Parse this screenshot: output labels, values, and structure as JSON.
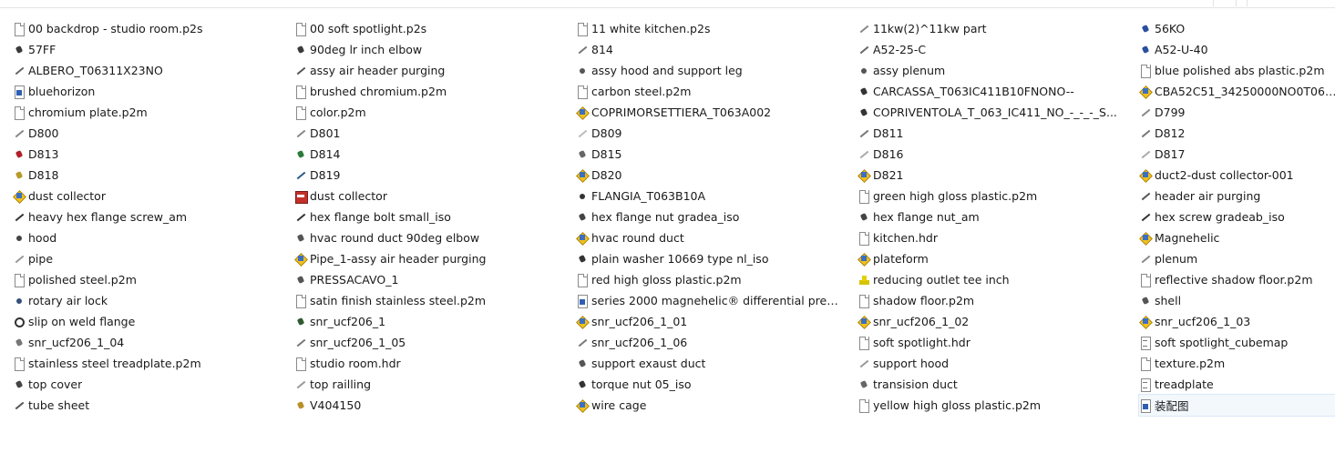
{
  "window": {
    "tabs": [
      "",
      ""
    ]
  },
  "files": [
    [
      {
        "name": "00 backdrop - studio room.p2s",
        "icon": "file-icon",
        "kind": "file"
      },
      {
        "name": "57FF",
        "icon": "part-icon",
        "kind": "part",
        "color": "#3a3a3a"
      },
      {
        "name": "ALBERO_T06311X23NO",
        "icon": "part-icon",
        "kind": "line",
        "color": "#666"
      },
      {
        "name": "bluehorizon",
        "icon": "image-file-icon",
        "kind": "doc-blue"
      },
      {
        "name": "chromium plate.p2m",
        "icon": "file-icon",
        "kind": "file"
      },
      {
        "name": "D800",
        "icon": "part-icon",
        "kind": "line",
        "color": "#888"
      },
      {
        "name": "D813",
        "icon": "part-icon",
        "kind": "part",
        "color": "#b0202a"
      },
      {
        "name": "D818",
        "icon": "part-icon",
        "kind": "part",
        "color": "#b89a2a"
      },
      {
        "name": "dust collector",
        "icon": "assembly-icon",
        "kind": "asm"
      },
      {
        "name": "heavy hex flange screw_am",
        "icon": "part-icon",
        "kind": "line",
        "color": "#333"
      },
      {
        "name": "hood",
        "icon": "part-icon",
        "kind": "dot",
        "color": "#444"
      },
      {
        "name": "pipe",
        "icon": "part-icon",
        "kind": "line",
        "color": "#999"
      },
      {
        "name": "polished steel.p2m",
        "icon": "file-icon",
        "kind": "file"
      },
      {
        "name": "rotary air lock",
        "icon": "part-icon",
        "kind": "dot",
        "color": "#35507a"
      },
      {
        "name": "slip on weld flange",
        "icon": "part-icon",
        "kind": "ring"
      },
      {
        "name": "snr_ucf206_1_04",
        "icon": "part-icon",
        "kind": "part",
        "color": "#777"
      },
      {
        "name": "stainless steel treadplate.p2m",
        "icon": "file-icon",
        "kind": "file"
      },
      {
        "name": "top cover",
        "icon": "part-icon",
        "kind": "part",
        "color": "#444"
      },
      {
        "name": "tube sheet",
        "icon": "part-icon",
        "kind": "line",
        "color": "#555"
      }
    ],
    [
      {
        "name": "00 soft spotlight.p2s",
        "icon": "file-icon",
        "kind": "file"
      },
      {
        "name": "90deg lr inch elbow",
        "icon": "part-icon",
        "kind": "part",
        "color": "#3a3a3a"
      },
      {
        "name": "assy air header purging",
        "icon": "part-icon",
        "kind": "line",
        "color": "#555"
      },
      {
        "name": "brushed chromium.p2m",
        "icon": "file-icon",
        "kind": "file"
      },
      {
        "name": "color.p2m",
        "icon": "file-icon",
        "kind": "file"
      },
      {
        "name": "D801",
        "icon": "part-icon",
        "kind": "line",
        "color": "#888"
      },
      {
        "name": "D814",
        "icon": "part-icon",
        "kind": "part",
        "color": "#2a7a3a"
      },
      {
        "name": "D819",
        "icon": "part-icon",
        "kind": "line",
        "color": "#2e5a8a"
      },
      {
        "name": "dust collector",
        "icon": "assembly-icon",
        "kind": "asm-red"
      },
      {
        "name": "hex flange bolt small_iso",
        "icon": "part-icon",
        "kind": "line",
        "color": "#333"
      },
      {
        "name": "hvac round duct 90deg elbow",
        "icon": "part-icon",
        "kind": "part",
        "color": "#555"
      },
      {
        "name": "Pipe_1-assy air header purging",
        "icon": "assembly-icon",
        "kind": "asm"
      },
      {
        "name": "PRESSACAVO_1",
        "icon": "part-icon",
        "kind": "part",
        "color": "#555"
      },
      {
        "name": "satin finish stainless steel.p2m",
        "icon": "file-icon",
        "kind": "file"
      },
      {
        "name": "snr_ucf206_1",
        "icon": "part-icon",
        "kind": "part",
        "color": "#2f5a2f"
      },
      {
        "name": "snr_ucf206_1_05",
        "icon": "part-icon",
        "kind": "line",
        "color": "#777"
      },
      {
        "name": "studio room.hdr",
        "icon": "file-icon",
        "kind": "file"
      },
      {
        "name": "top railling",
        "icon": "part-icon",
        "kind": "line",
        "color": "#999"
      },
      {
        "name": "V404150",
        "icon": "part-icon",
        "kind": "part",
        "color": "#b8902a"
      }
    ],
    [
      {
        "name": "11 white kitchen.p2s",
        "icon": "file-icon",
        "kind": "file"
      },
      {
        "name": "814",
        "icon": "part-icon",
        "kind": "line",
        "color": "#777"
      },
      {
        "name": "assy hood and support leg",
        "icon": "part-icon",
        "kind": "dot",
        "color": "#555"
      },
      {
        "name": "carbon steel.p2m",
        "icon": "file-icon",
        "kind": "file"
      },
      {
        "name": "COPRIMORSETTIERA_T063A002",
        "icon": "assembly-icon",
        "kind": "asm"
      },
      {
        "name": "D809",
        "icon": "part-icon",
        "kind": "line",
        "color": "#bbb"
      },
      {
        "name": "D815",
        "icon": "part-icon",
        "kind": "part",
        "color": "#666"
      },
      {
        "name": "D820",
        "icon": "assembly-icon",
        "kind": "asm"
      },
      {
        "name": "FLANGIA_T063B10A",
        "icon": "part-icon",
        "kind": "dot",
        "color": "#333"
      },
      {
        "name": "hex flange nut gradea_iso",
        "icon": "part-icon",
        "kind": "part",
        "color": "#444"
      },
      {
        "name": "hvac round duct",
        "icon": "assembly-icon",
        "kind": "asm"
      },
      {
        "name": "plain washer 10669 type nl_iso",
        "icon": "part-icon",
        "kind": "part",
        "color": "#333"
      },
      {
        "name": "red high gloss plastic.p2m",
        "icon": "file-icon",
        "kind": "file"
      },
      {
        "name": "series 2000 magnehelic® differential pres...",
        "icon": "image-file-icon",
        "kind": "doc-blue"
      },
      {
        "name": "snr_ucf206_1_01",
        "icon": "assembly-icon",
        "kind": "asm"
      },
      {
        "name": "snr_ucf206_1_06",
        "icon": "part-icon",
        "kind": "line",
        "color": "#777"
      },
      {
        "name": "support exaust duct",
        "icon": "part-icon",
        "kind": "part",
        "color": "#555"
      },
      {
        "name": "torque nut 05_iso",
        "icon": "part-icon",
        "kind": "part",
        "color": "#333"
      },
      {
        "name": "wire cage",
        "icon": "assembly-icon",
        "kind": "asm"
      }
    ],
    [
      {
        "name": "11kw(2)^11kw part",
        "icon": "part-icon",
        "kind": "line",
        "color": "#888"
      },
      {
        "name": "A52-25-C",
        "icon": "part-icon",
        "kind": "line",
        "color": "#666"
      },
      {
        "name": "assy plenum",
        "icon": "part-icon",
        "kind": "dot",
        "color": "#555"
      },
      {
        "name": "CARCASSA_T063IC411B10FNONO--",
        "icon": "part-icon",
        "kind": "part",
        "color": "#333"
      },
      {
        "name": "COPRIVENTOLA_T_063_IC411_NO_-_-_-_S...",
        "icon": "part-icon",
        "kind": "part",
        "color": "#333"
      },
      {
        "name": "D811",
        "icon": "part-icon",
        "kind": "line",
        "color": "#777"
      },
      {
        "name": "D816",
        "icon": "part-icon",
        "kind": "line",
        "color": "#aaa"
      },
      {
        "name": "D821",
        "icon": "assembly-icon",
        "kind": "asm"
      },
      {
        "name": "green high gloss plastic.p2m",
        "icon": "file-icon",
        "kind": "file"
      },
      {
        "name": "hex flange nut_am",
        "icon": "part-icon",
        "kind": "part",
        "color": "#444"
      },
      {
        "name": "kitchen.hdr",
        "icon": "file-icon",
        "kind": "file"
      },
      {
        "name": "plateform",
        "icon": "assembly-icon",
        "kind": "asm"
      },
      {
        "name": "reducing outlet tee inch",
        "icon": "part-icon",
        "kind": "tee"
      },
      {
        "name": "shadow floor.p2m",
        "icon": "file-icon",
        "kind": "file"
      },
      {
        "name": "snr_ucf206_1_02",
        "icon": "assembly-icon",
        "kind": "asm"
      },
      {
        "name": "soft spotlight.hdr",
        "icon": "file-icon",
        "kind": "file"
      },
      {
        "name": "support hood",
        "icon": "part-icon",
        "kind": "line",
        "color": "#999"
      },
      {
        "name": "transision duct",
        "icon": "part-icon",
        "kind": "part",
        "color": "#666"
      },
      {
        "name": "yellow high gloss plastic.p2m",
        "icon": "file-icon",
        "kind": "file"
      }
    ],
    [
      {
        "name": "56KO",
        "icon": "part-icon",
        "kind": "part",
        "color": "#2a4f9e"
      },
      {
        "name": "A52-U-40",
        "icon": "part-icon",
        "kind": "part",
        "color": "#2a4f9e"
      },
      {
        "name": "blue polished abs plastic.p2m",
        "icon": "file-icon",
        "kind": "file"
      },
      {
        "name": "CBA52C51_34250000NO0T0631-(-...",
        "icon": "assembly-icon",
        "kind": "asm"
      },
      {
        "name": "D799",
        "icon": "part-icon",
        "kind": "line",
        "color": "#888"
      },
      {
        "name": "D812",
        "icon": "part-icon",
        "kind": "line",
        "color": "#777"
      },
      {
        "name": "D817",
        "icon": "part-icon",
        "kind": "line",
        "color": "#aaa"
      },
      {
        "name": "duct2-dust collector-001",
        "icon": "assembly-icon",
        "kind": "asm"
      },
      {
        "name": "header air purging",
        "icon": "part-icon",
        "kind": "line",
        "color": "#555"
      },
      {
        "name": "hex screw gradeab_iso",
        "icon": "part-icon",
        "kind": "line",
        "color": "#333"
      },
      {
        "name": "Magnehelic",
        "icon": "assembly-icon",
        "kind": "asm"
      },
      {
        "name": "plenum",
        "icon": "part-icon",
        "kind": "line",
        "color": "#888"
      },
      {
        "name": "reflective shadow floor.p2m",
        "icon": "file-icon",
        "kind": "file"
      },
      {
        "name": "shell",
        "icon": "part-icon",
        "kind": "part",
        "color": "#555"
      },
      {
        "name": "snr_ucf206_1_03",
        "icon": "assembly-icon",
        "kind": "asm"
      },
      {
        "name": "soft spotlight_cubemap",
        "icon": "document-icon",
        "kind": "doc-lines"
      },
      {
        "name": "texture.p2m",
        "icon": "file-icon",
        "kind": "file"
      },
      {
        "name": "treadplate",
        "icon": "document-icon",
        "kind": "doc-lines"
      },
      {
        "name": "装配图",
        "icon": "image-file-icon",
        "kind": "doc-blue",
        "selected": true
      }
    ]
  ]
}
